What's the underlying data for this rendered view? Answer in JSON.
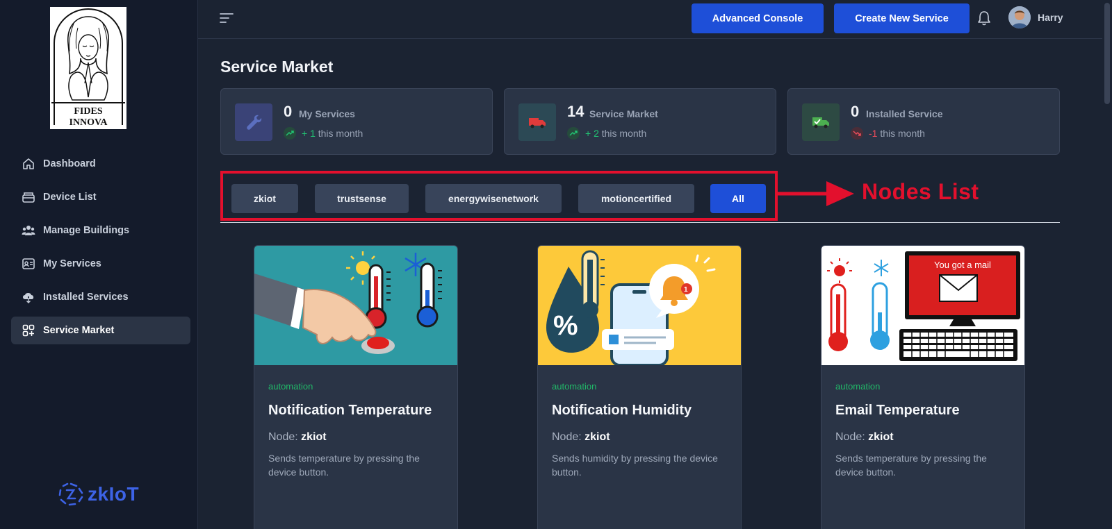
{
  "brand": {
    "logo_text_line1": "FIDES",
    "logo_text_line2": "INNOVA",
    "footer_logo": "zkIoT"
  },
  "sidebar": {
    "items": [
      {
        "label": "Dashboard",
        "icon": "home-icon",
        "active": false
      },
      {
        "label": "Device List",
        "icon": "device-icon",
        "active": false
      },
      {
        "label": "Manage Buildings",
        "icon": "people-icon",
        "active": false
      },
      {
        "label": "My Services",
        "icon": "id-card-icon",
        "active": false
      },
      {
        "label": "Installed Services",
        "icon": "cloud-download-icon",
        "active": false
      },
      {
        "label": "Service Market",
        "icon": "grid-plus-icon",
        "active": true
      }
    ]
  },
  "topbar": {
    "console_label": "Advanced Console",
    "create_label": "Create New Service",
    "user_name": "Harry"
  },
  "page": {
    "title": "Service Market"
  },
  "stats": [
    {
      "value": "0",
      "label": "My Services",
      "trend_value": "+ 1",
      "trend_text": "this month",
      "direction": "up",
      "icon": "wrench-icon",
      "icon_bg": "#3a4377",
      "icon_color": "#5b6fbf"
    },
    {
      "value": "14",
      "label": "Service Market",
      "trend_value": "+ 2",
      "trend_text": "this month",
      "direction": "up",
      "icon": "truck-icon",
      "icon_bg": "#2c4955",
      "icon_color": "#e03b3b"
    },
    {
      "value": "0",
      "label": "Installed Service",
      "trend_value": "-1",
      "trend_text": "this month",
      "direction": "down",
      "icon": "delivery-truck-icon",
      "icon_bg": "#2d4a43",
      "icon_color": "#4caf50"
    }
  ],
  "nodes": {
    "items": [
      "zkiot",
      "trustsense",
      "energywisenetwork",
      "motioncertified",
      "All"
    ],
    "active": "All",
    "annotation": "Nodes List"
  },
  "colors": {
    "accent": "#1e4fd8",
    "annotation": "#e3102d",
    "tag": "#21b868"
  },
  "cards": [
    {
      "tag": "automation",
      "title": "Notification Temperature",
      "node_label": "Node:",
      "node_value": "zkiot",
      "description": "Sends temperature by pressing the device button.",
      "image": "hand-pressing-button-thermometer-image"
    },
    {
      "tag": "automation",
      "title": "Notification Humidity",
      "node_label": "Node:",
      "node_value": "zkiot",
      "description": "Sends humidity by pressing the device button.",
      "image": "humidity-phone-notification-image"
    },
    {
      "tag": "automation",
      "title": "Email Temperature",
      "node_label": "Node:",
      "node_value": "zkiot",
      "description": "Sends temperature by pressing the device button.",
      "image": "computer-mail-thermometer-image",
      "image_text": "You got a mail"
    }
  ]
}
